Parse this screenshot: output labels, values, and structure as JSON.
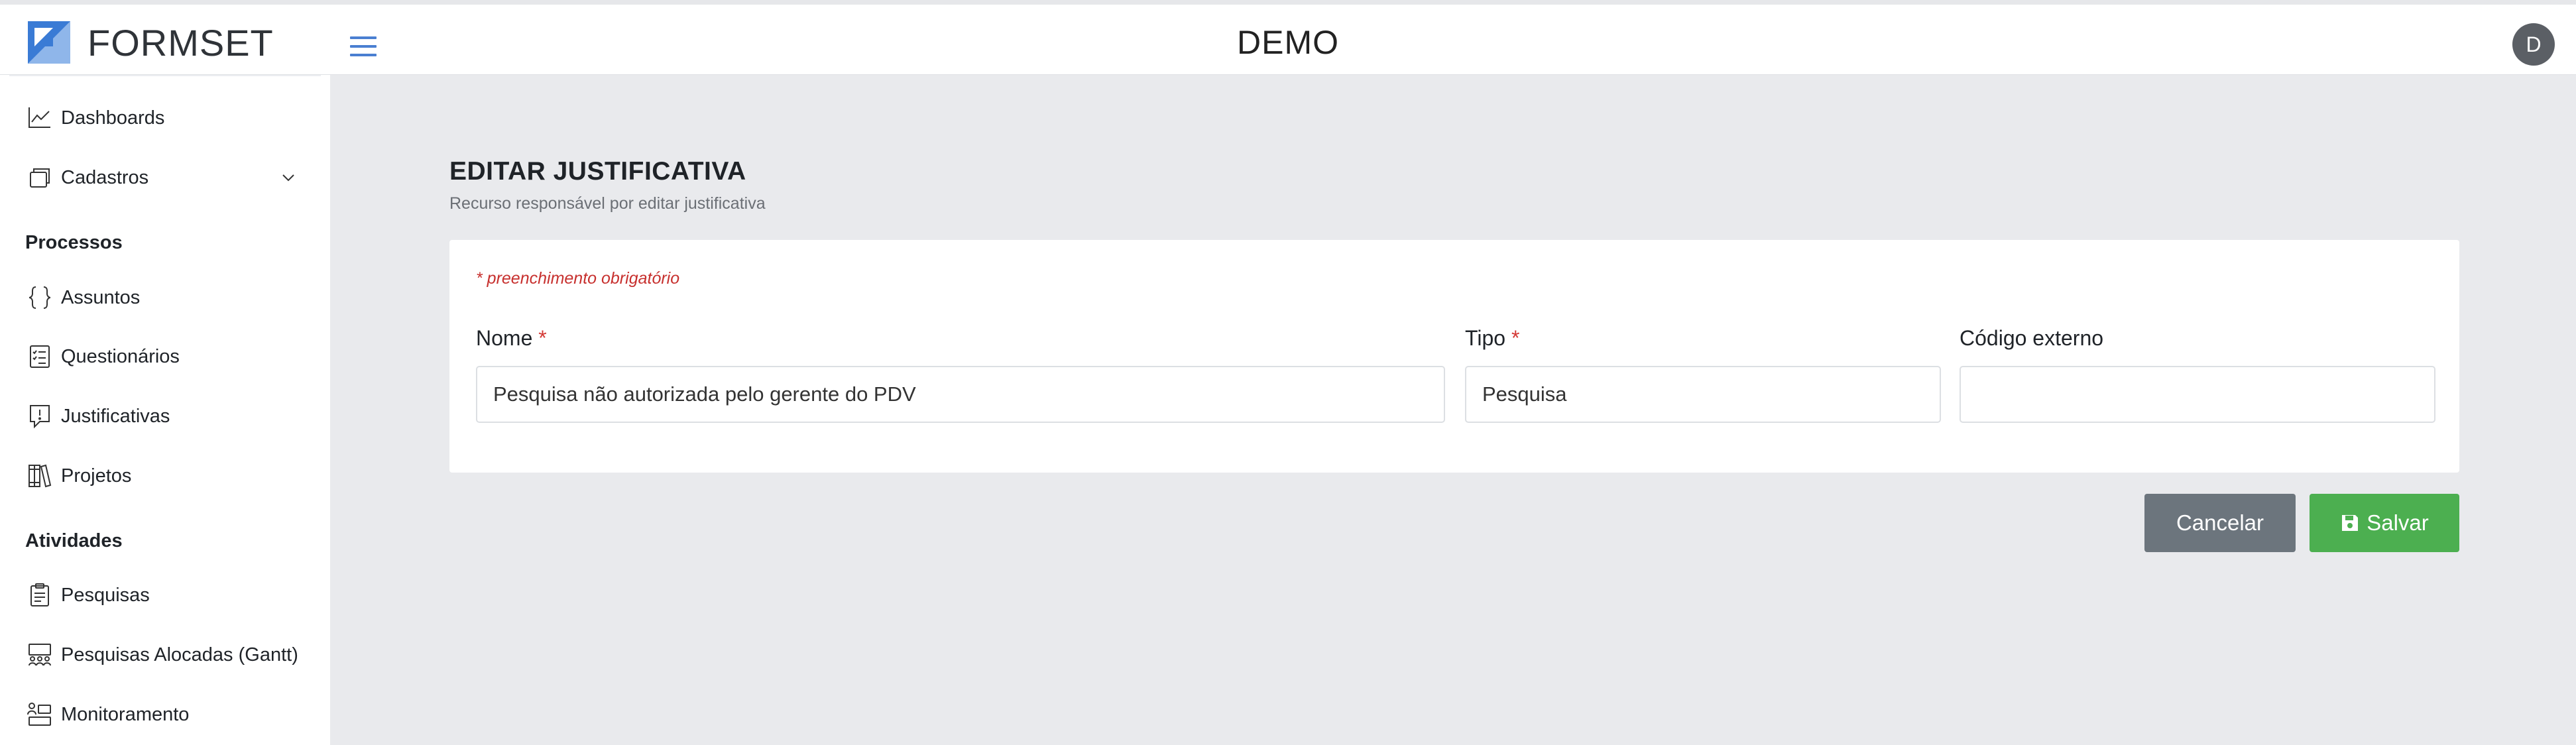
{
  "header": {
    "logo_text": "FORMSET",
    "app_title": "DEMO",
    "avatar_initial": "D"
  },
  "sidebar": {
    "dashboards": "Dashboards",
    "cadastros": "Cadastros",
    "section_processos": "Processos",
    "assuntos": "Assuntos",
    "questionarios": "Questionários",
    "justificativas": "Justificativas",
    "projetos": "Projetos",
    "section_atividades": "Atividades",
    "pesquisas": "Pesquisas",
    "pesquisas_alocadas": "Pesquisas Alocadas (Gantt)",
    "monitoramento": "Monitoramento"
  },
  "page": {
    "title": "EDITAR JUSTIFICATIVA",
    "subtitle": "Recurso responsável por editar justificativa"
  },
  "form": {
    "required_note": "* preenchimento obrigatório",
    "nome_label": "Nome",
    "nome_value": "Pesquisa não autorizada pelo gerente do PDV",
    "tipo_label": "Tipo",
    "tipo_value": "Pesquisa",
    "codigo_label": "Código externo",
    "codigo_value": "",
    "required_mark": "*"
  },
  "actions": {
    "cancel": "Cancelar",
    "save": "Salvar"
  },
  "colors": {
    "accent": "#4a7fd1",
    "save": "#4caf50",
    "cancel": "#6c757d",
    "required": "#d43a36",
    "content_bg": "#e9eaed"
  }
}
